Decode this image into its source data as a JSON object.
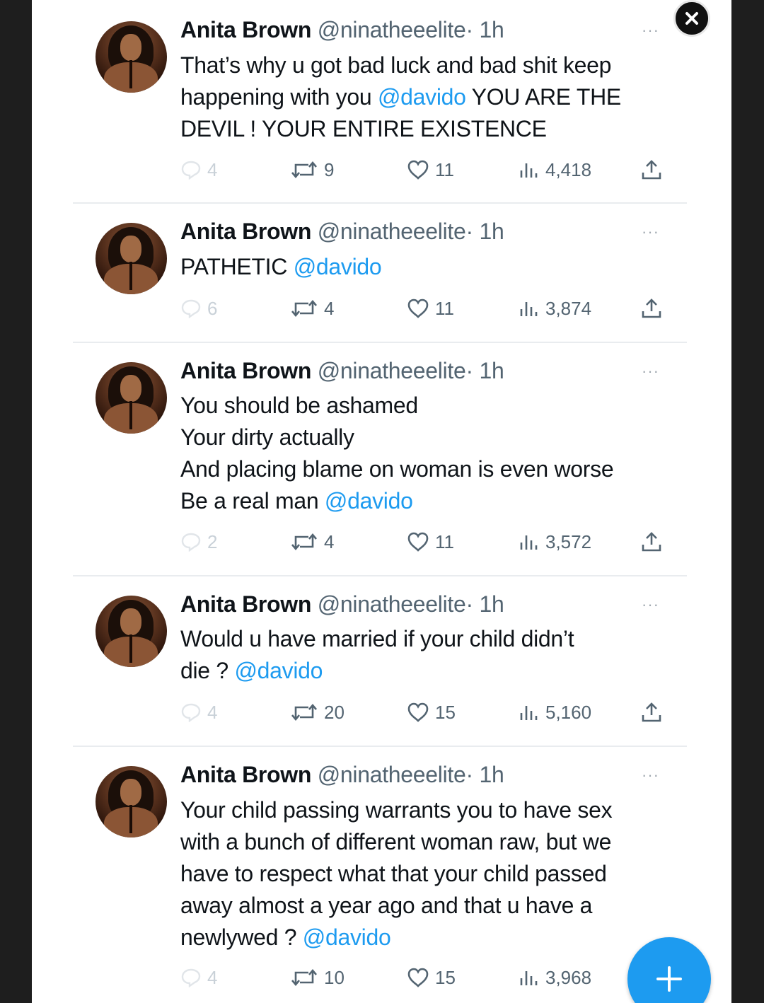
{
  "tweets": [
    {
      "name": "Anita Brown",
      "handle": "@ninatheeelite",
      "time": "· 1h",
      "lines": [
        [
          {
            "t": "That’s why u got bad luck and bad shit keep"
          }
        ],
        [
          {
            "t": "happening with you "
          },
          {
            "t": "@davido",
            "m": true
          },
          {
            "t": " YOU ARE THE"
          }
        ],
        [
          {
            "t": "DEVIL ! YOUR ENTIRE EXISTENCE"
          }
        ]
      ],
      "replies": "4",
      "retweets": "9",
      "likes": "11",
      "views": "4,418"
    },
    {
      "name": "Anita Brown",
      "handle": "@ninatheeelite",
      "time": "· 1h",
      "lines": [
        [
          {
            "t": "PATHETIC "
          },
          {
            "t": "@davido",
            "m": true
          }
        ]
      ],
      "replies": "6",
      "retweets": "4",
      "likes": "11",
      "views": "3,874"
    },
    {
      "name": "Anita Brown",
      "handle": "@ninatheeelite",
      "time": "· 1h",
      "lines": [
        [
          {
            "t": "You should be ashamed"
          }
        ],
        [
          {
            "t": "Your dirty actually"
          }
        ],
        [
          {
            "t": "And placing blame on woman is even worse"
          }
        ],
        [
          {
            "t": "Be a real man "
          },
          {
            "t": "@davido",
            "m": true
          }
        ]
      ],
      "replies": "2",
      "retweets": "4",
      "likes": "11",
      "views": "3,572"
    },
    {
      "name": "Anita Brown",
      "handle": "@ninatheeelite",
      "time": "· 1h",
      "lines": [
        [
          {
            "t": "Would u have married if your child didn’t"
          }
        ],
        [
          {
            "t": "die ? "
          },
          {
            "t": "@davido",
            "m": true
          }
        ]
      ],
      "replies": "4",
      "retweets": "20",
      "likes": "15",
      "views": "5,160"
    },
    {
      "name": "Anita Brown",
      "handle": "@ninatheeelite",
      "time": "· 1h",
      "lines": [
        [
          {
            "t": "Your child passing warrants you to have sex"
          }
        ],
        [
          {
            "t": "with a bunch of different woman raw, but we"
          }
        ],
        [
          {
            "t": "have to respect what that your child passed"
          }
        ],
        [
          {
            "t": "away almost a year ago and that u have a"
          }
        ],
        [
          {
            "t": "newlywed ? "
          },
          {
            "t": "@davido",
            "m": true
          }
        ]
      ],
      "replies": "4",
      "retweets": "10",
      "likes": "15",
      "views": "3,968"
    }
  ],
  "more_label": "···",
  "colors": {
    "accent": "#1d9bf0",
    "text": "#0f1419",
    "muted": "#536471"
  },
  "icons": {
    "reply": "reply-icon",
    "retweet": "retweet-icon",
    "like": "heart-icon",
    "views": "views-icon",
    "share": "share-icon",
    "close": "close-icon",
    "compose": "plus-icon"
  }
}
